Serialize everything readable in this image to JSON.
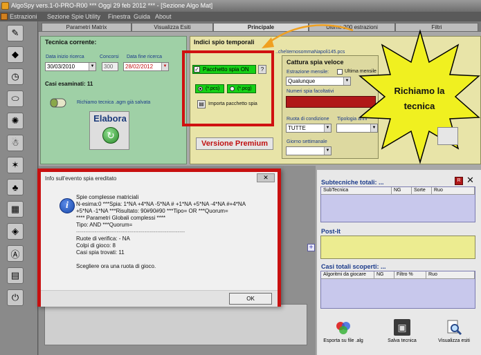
{
  "window": {
    "title": "AlgoSpy vers.1-0-PRO-R00   ***   Oggi 29 feb 2012   ***   - [Sezione Algo Mat]"
  },
  "menu": [
    "Estrazioni",
    "Sezione Spie",
    "Utility",
    "Finestra",
    "Guida",
    "About"
  ],
  "tabs": [
    "Parametri Matrix",
    "Visualizza Esiti",
    "Principale",
    "Ultime 200 estrazioni",
    "Filtri"
  ],
  "tecnica": {
    "title": "Tecnica corrente:",
    "data_inizio_label": "Data inizio ricerca",
    "data_inizio": "30/03/2010",
    "concorsi_label": "Concorsi",
    "concorsi": "300",
    "data_fine_label": "Data fine ricerca",
    "data_fine": "28/02/2012",
    "casi_esaminati": "Casi esaminati: 11",
    "salvata": "Richiamo tecnica .agm già salvata",
    "elabora": "Elabora"
  },
  "indici": {
    "title": "Indici spio temporali",
    "path": "..che\\ternosommaNapoli145.pcs",
    "pacchetto_on": "Pacchetto spia ON",
    "help": "?",
    "pcs": "(*.pcs)",
    "pcg": "(*.pcg)",
    "importa": "Importa pacchetto spia",
    "versione": "Versione Premium"
  },
  "cattura": {
    "title": "Cattura spia veloce",
    "estrazione_label": "Estrazione mensile:",
    "ultima_mensile": "Ultima mensile",
    "qualunque": "Qualunque",
    "numeri_label": "Numeri spia facoltativi",
    "ruota_label": "Ruota di condizione",
    "ruota": "TUTTE",
    "tipologia_label": "Tipologia anni",
    "giorno_label": "Giorno settimanale"
  },
  "callout": {
    "line1": "Richiamo la",
    "line2": "tecnica"
  },
  "dialog": {
    "title": "Info sull'evento spia ereditato",
    "close": "✕",
    "lines": [
      "Spie complesse matriciali",
      "N-esima:0 ***Spia: 1*NA +4*NA -5*NA # +1*NA +5*NA -4*NA #+4*NA",
      "+5*NA -1*NA ***Risultato: 90#90#90 ***Tipo= OR ***Quorum=",
      "**** Parametri Globali complessi ****",
      "Tipo: AND  ***Quorum=",
      "-----------------------------------------------------------",
      "Ruote di verifica:  - NA",
      "Colpi di gioco: 8",
      "Casi spia trovati: 11",
      "",
      "Scegliere ora una ruota di gioco."
    ],
    "ok": "OK"
  },
  "subtecniche": {
    "title": "Subtecniche totali:  ...",
    "cols": [
      "SubTecnica",
      "NG",
      "Sorte",
      "Ruo"
    ]
  },
  "postit": {
    "title": "Post-It"
  },
  "casi": {
    "title": "Casi totali scoperti:  ...",
    "cols": [
      "Algoritmi da giocare",
      "NG",
      "Filtro %",
      "Ruo"
    ]
  },
  "buttons": {
    "esporta": "Esporta su file .alg",
    "salva": "Salva tecnica",
    "visualizza": "Visualizza esiti"
  },
  "colors": {
    "green_panel": "#9fd0a6",
    "yellow_panel": "#e8e4a8",
    "highlight_red": "#d01010",
    "star_yellow": "#f0f020"
  }
}
